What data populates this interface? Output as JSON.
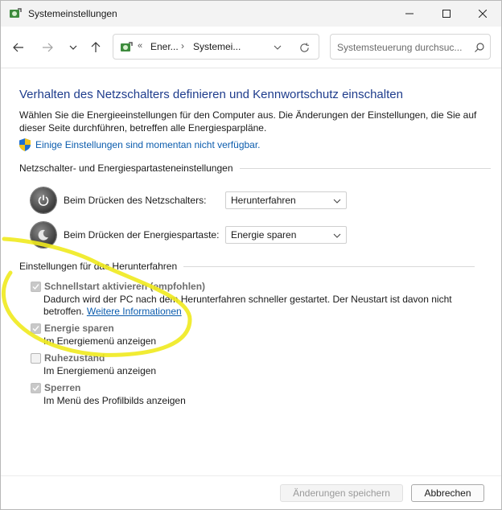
{
  "window": {
    "title": "Systemeinstellungen",
    "icon": "power-options-icon"
  },
  "address_bar": {
    "chevron": "«",
    "segments": [
      "Ener...",
      "Systemei..."
    ],
    "separator": "›"
  },
  "search": {
    "placeholder": "Systemsteuerung durchsuc..."
  },
  "main": {
    "title": "Verhalten des Netzschalters definieren und Kennwortschutz einschalten",
    "intro": "Wählen Sie die Energieeinstellungen für den Computer aus. Die Änderungen der Einstellungen, die Sie auf dieser Seite durchführen, betreffen alle Energiesparpläne.",
    "unavailable_link": "Einige Einstellungen sind momentan nicht verfügbar."
  },
  "power_section": {
    "heading": "Netzschalter- und Energiespartasteneinstellungen",
    "rows": [
      {
        "label": "Beim Drücken des Netzschalters:",
        "value": "Herunterfahren"
      },
      {
        "label": "Beim Drücken der Energiespartaste:",
        "value": "Energie sparen"
      }
    ]
  },
  "shutdown_section": {
    "heading": "Einstellungen für das Herunterfahren",
    "options": [
      {
        "label": "Schnellstart aktivieren (empfohlen)",
        "checked": true,
        "desc_line1": "Dadurch wird der PC nach dem Herunterfahren schneller gestartet. Der Neustart ist davon nicht",
        "desc_line2": "betroffen.",
        "link": "Weitere Informationen"
      },
      {
        "label": "Energie sparen",
        "checked": true,
        "desc": "Im Energiemenü anzeigen"
      },
      {
        "label": "Ruhezustand",
        "checked": false,
        "desc": "Im Energiemenü anzeigen"
      },
      {
        "label": "Sperren",
        "checked": true,
        "desc": "Im Menü des Profilbilds anzeigen"
      }
    ]
  },
  "footer": {
    "save": "Änderungen speichern",
    "cancel": "Abbrechen"
  },
  "colors": {
    "title_blue": "#1e3c8c",
    "link_blue": "#0b5cad",
    "highlight_yellow": "#f0ea1e"
  }
}
